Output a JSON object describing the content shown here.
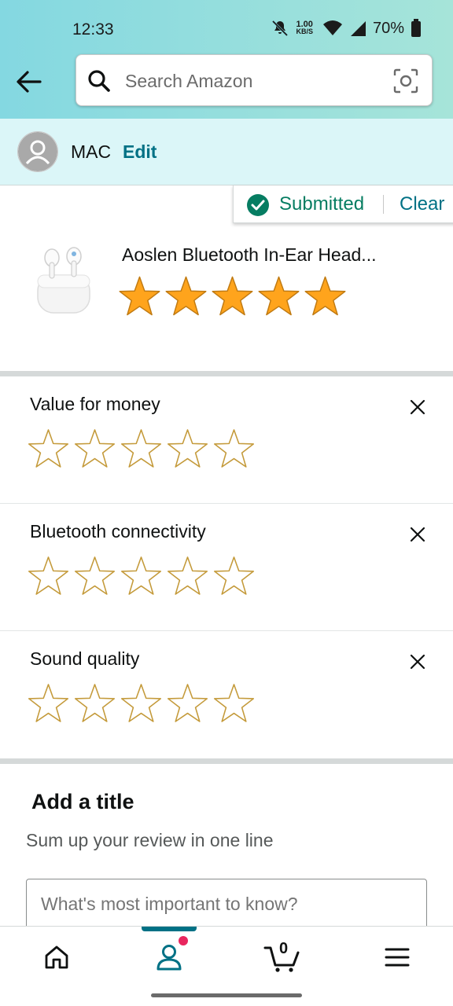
{
  "status_bar": {
    "time": "12:33",
    "net_speed_value": "1.00",
    "net_speed_unit": "KB/S",
    "battery": "70%",
    "icons": [
      "mute-bell-icon",
      "wifi-icon",
      "signal-icon",
      "battery-icon"
    ]
  },
  "search": {
    "placeholder": "Search Amazon"
  },
  "user": {
    "name": "MAC",
    "edit_label": "Edit"
  },
  "submission": {
    "status_label": "Submitted",
    "clear_label": "Clear"
  },
  "product": {
    "title": "Aoslen Bluetooth In-Ear Head...",
    "overall_rating": 5,
    "max_rating": 5
  },
  "attributes": [
    {
      "label": "Value for money",
      "rating": 0,
      "max": 5
    },
    {
      "label": "Bluetooth connectivity",
      "rating": 0,
      "max": 5
    },
    {
      "label": "Sound quality",
      "rating": 0,
      "max": 5
    }
  ],
  "title_section": {
    "heading": "Add a title",
    "subheading": "Sum up your review in one line",
    "placeholder": "What's most important to know?"
  },
  "bottom_nav": {
    "items": [
      "home-icon",
      "account-icon",
      "cart-icon",
      "menu-icon"
    ],
    "active": "account",
    "cart_count": "0"
  },
  "colors": {
    "accent": "#007185",
    "success": "#067d62",
    "star_fill": "#ffa41c",
    "star_outline": "#c49a3a",
    "notification_dot": "#e8265e"
  }
}
